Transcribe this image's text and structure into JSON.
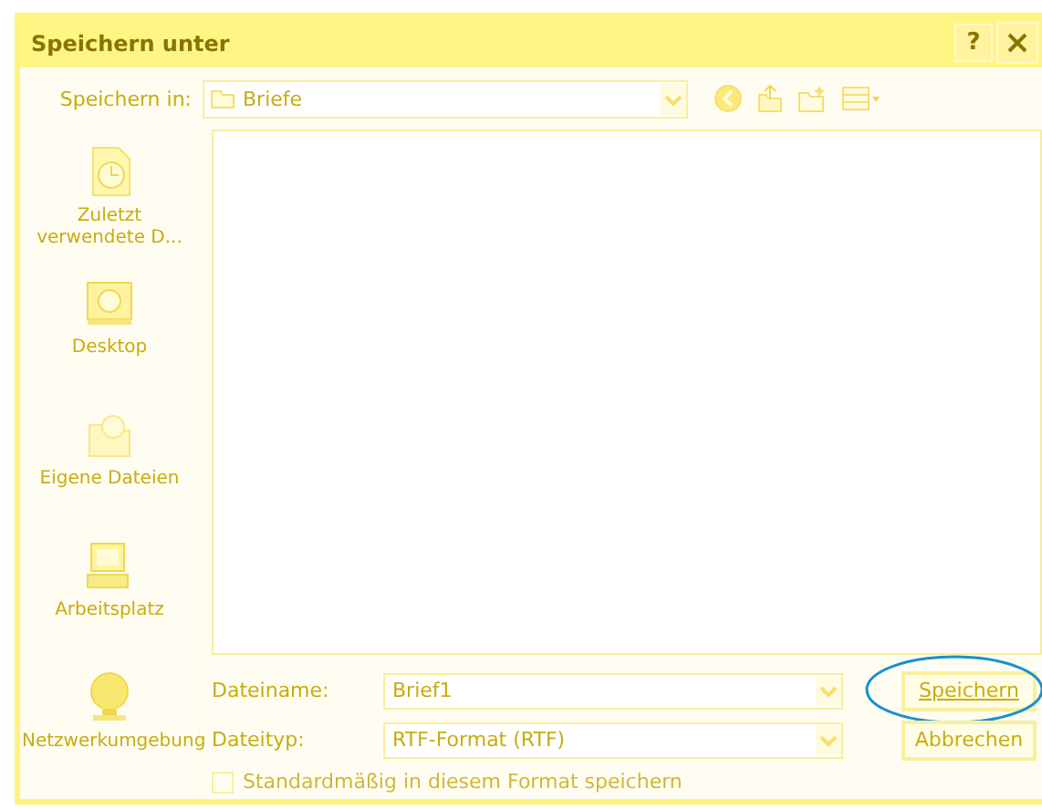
{
  "window": {
    "title": "Speichern unter",
    "help_button": "?"
  },
  "save_in": {
    "label": "Speichern in:",
    "value": "Briefe"
  },
  "places": [
    {
      "kind": "recent",
      "label": "Zuletzt verwendete D..."
    },
    {
      "kind": "desktop",
      "label": "Desktop"
    },
    {
      "kind": "documents",
      "label": "Eigene Dateien"
    },
    {
      "kind": "computer",
      "label": "Arbeitsplatz"
    },
    {
      "kind": "network",
      "label": "Netzwerkumgebung"
    }
  ],
  "fields": [
    {
      "label": "Dateiname:",
      "value": "Brief1"
    },
    {
      "label": "Dateityp:",
      "value": "RTF-Format (RTF)"
    }
  ],
  "buttons": [
    {
      "label": "Speichern",
      "circled": true
    },
    {
      "label": "Abbrechen",
      "circled": false
    }
  ],
  "checkbox": {
    "label": "Standardmäßig in diesem Format speichern",
    "checked": false,
    "disabled": true
  }
}
